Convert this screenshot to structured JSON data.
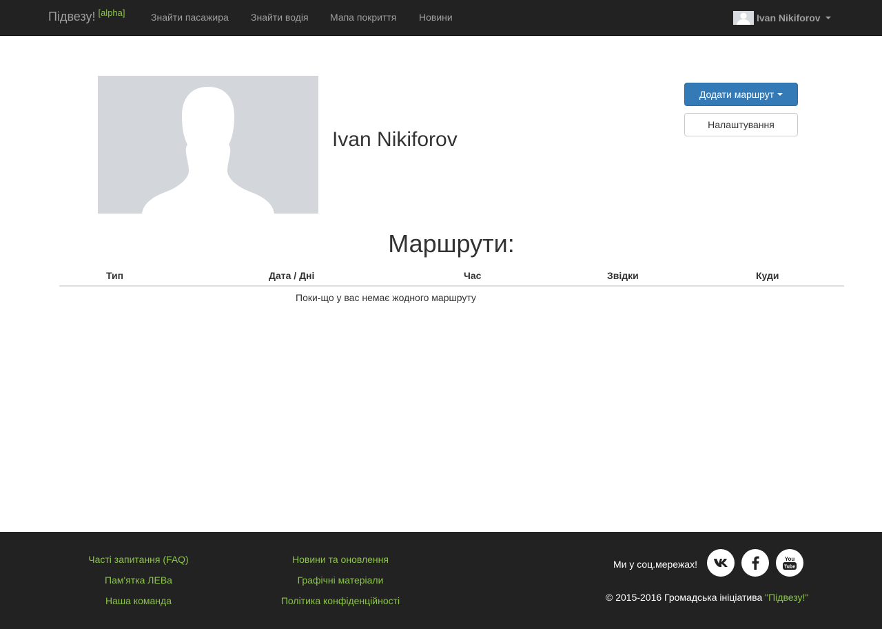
{
  "navbar": {
    "brand": "Підвезу!",
    "brand_badge": "[alpha]",
    "links": [
      "Знайти пасажира",
      "Знайти водія",
      "Мапа покриття",
      "Новини"
    ],
    "user_name": "Ivan Nikiforov"
  },
  "profile": {
    "name": "Ivan Nikiforov",
    "add_route_label": "Додати маршрут",
    "settings_label": "Налаштування"
  },
  "routes": {
    "title": "Маршрути:",
    "columns": [
      "Тип",
      "Дата / Дні",
      "Час",
      "Звідки",
      "Куди"
    ],
    "empty_message": "Поки-що у вас немає жодного маршруту"
  },
  "footer": {
    "col1": [
      "Часті запитання (FAQ)",
      "Пам'ятка ЛЕВа",
      "Наша команда"
    ],
    "col2": [
      "Новини та оновлення",
      "Графічні матеріали",
      "Політика конфіденційності"
    ],
    "social_label": "Ми у соц.мережах!",
    "social_icons": [
      "vk-icon",
      "facebook-icon",
      "youtube-icon"
    ],
    "youtube_text": "You Tube",
    "copyright_prefix": "© 2015-2016 Громадська ініціатива ",
    "copyright_highlight": "\"Підвезу!\""
  },
  "colors": {
    "navbar_bg": "#222222",
    "accent_green": "#8bc34a",
    "primary_button": "#337ab7"
  }
}
